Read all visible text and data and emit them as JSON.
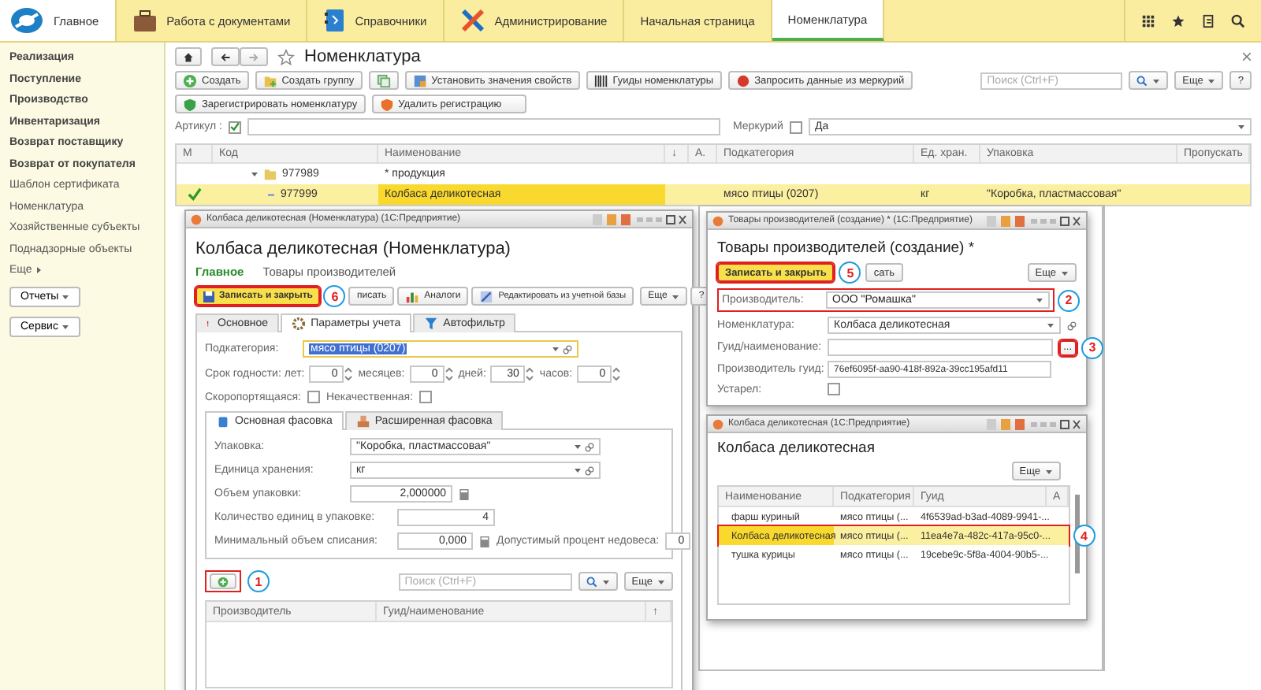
{
  "top_bar": {
    "sections": [
      {
        "label": "Главное",
        "kind": "logo"
      },
      {
        "label": "Работа с документами",
        "kind": "briefcase"
      },
      {
        "label": "Справочники",
        "kind": "book"
      },
      {
        "label": "Администрирование",
        "kind": "tools"
      }
    ],
    "tabs": [
      {
        "label": "Начальная страница",
        "selected": false
      },
      {
        "label": "Номенклатура",
        "selected": true
      }
    ]
  },
  "sidebar": {
    "items": [
      {
        "label": "Реализация",
        "kind": "section"
      },
      {
        "label": "Поступление",
        "kind": "section"
      },
      {
        "label": "Производство",
        "kind": "section"
      },
      {
        "label": "Инвентаризация",
        "kind": "section"
      },
      {
        "label": "Возврат поставщику",
        "kind": "section"
      },
      {
        "label": "Возврат от покупателя",
        "kind": "section"
      },
      {
        "label": "Шаблон сертификата",
        "kind": "link"
      },
      {
        "label": "Номенклатура",
        "kind": "link"
      },
      {
        "label": "Хозяйственные субъекты",
        "kind": "link"
      },
      {
        "label": "Поднадзорные объекты",
        "kind": "link"
      },
      {
        "label": "Еще",
        "kind": "more"
      }
    ],
    "buttons": [
      "Отчеты",
      "Сервис"
    ]
  },
  "list_page": {
    "title": "Номенклатура",
    "toolbar": [
      {
        "label": "Создать",
        "kind": "create"
      },
      {
        "label": "Создать группу",
        "kind": "group"
      },
      {
        "kind": "copy"
      },
      {
        "label": "Установить значения свойств",
        "kind": "properties"
      },
      {
        "label": "Гуиды номенклатуры",
        "kind": "barcode"
      },
      {
        "label": "Запросить данные из меркурий",
        "kind": "request"
      }
    ],
    "toolbar2": [
      {
        "label": "Зарегистрировать номенклатуру",
        "kind": "register"
      },
      {
        "label": "Удалить регистрацию",
        "kind": "unregister"
      }
    ],
    "search_placeholder": "Поиск (Ctrl+F)",
    "more": "Еще",
    "help": "?",
    "filters": {
      "article_label": "Артикул :",
      "article_checked": true,
      "mercury_label": "Меркурий",
      "mercury_checked": false,
      "mercury_value": "Да"
    },
    "table": {
      "columns": [
        "М",
        "Код",
        "Наименование",
        "↓",
        "А.",
        "Подкатегория",
        "Ед. хран.",
        "Упаковка",
        "Пропускать"
      ],
      "rows": [
        {
          "kind": "group",
          "expanded": true,
          "marked": false,
          "selected": false,
          "cells": [
            "",
            "977989",
            "* продукция",
            "",
            "",
            "",
            "",
            "",
            ""
          ]
        },
        {
          "kind": "item",
          "marked": true,
          "selected": true,
          "cells": [
            "",
            "977999",
            "Колбаса деликотесная",
            "",
            "",
            "мясо птицы (0207)",
            "кг",
            "\"Коробка, пластмассовая\"",
            ""
          ]
        }
      ]
    }
  },
  "item_window": {
    "title": "Колбаса деликотесная (Номенклатура) (1С:Предприятие)",
    "heading": "Колбаса деликотесная (Номенклатура)",
    "nav": [
      {
        "label": "Главное",
        "selected": true
      },
      {
        "label": "Товары производителей",
        "selected": false
      }
    ],
    "save_close": "Записать и закрыть",
    "callout_save": "6",
    "save": "писать",
    "analogs": "Аналоги",
    "edit_base": "Редактировать из учетной базы",
    "more": "Еще",
    "help": "?",
    "tabs": [
      {
        "label": "Основное",
        "selected": false,
        "kind": "warning"
      },
      {
        "label": "Параметры учета",
        "selected": true,
        "kind": "gear"
      },
      {
        "label": "Автофильтр",
        "selected": false,
        "kind": "filter"
      }
    ],
    "subcategory_label": "Подкатегория:",
    "subcategory": "мясо птицы (0207)",
    "shelf_life": [
      {
        "label": "Срок годности: лет:",
        "value": "0"
      },
      {
        "label": "месяцев:",
        "value": "0"
      },
      {
        "label": "дней:",
        "value": "30"
      },
      {
        "label": "часов:",
        "value": "0"
      }
    ],
    "flags": [
      {
        "label": "Скоропортящаяся:",
        "checked": false
      },
      {
        "label": "Некачественная:",
        "checked": false
      }
    ],
    "pack_tabs": [
      {
        "label": "Основная фасовка",
        "selected": true
      },
      {
        "label": "Расширенная фасовка",
        "selected": false
      }
    ],
    "packaging_label": "Упаковка:",
    "packaging": "\"Коробка, пластмассовая\"",
    "unit_label": "Единица хранения:",
    "unit": "кг",
    "volume_label": "Объем упаковки:",
    "volume": "2,000000",
    "count_label": "Количество единиц в упаковке:",
    "count": "4",
    "min_label": "Минимальный объем списания:",
    "min": "0,000",
    "underweight_label": "Допустимый процент недовеса:",
    "underweight": "0",
    "callout_add": "1",
    "search_placeholder": "Поиск (Ctrl+F)",
    "table_more": "Еще",
    "columns": [
      "Производитель",
      "Гуид/наименование",
      "↑"
    ]
  },
  "producer_window": {
    "title": "Товары производителей (создание) * (1С:Предприятие)",
    "heading": "Товары производителей (создание) *",
    "save_close": "Записать и закрыть",
    "callout_save": "5",
    "save": "сать",
    "more": "Еще",
    "producer_label": "Производитель:",
    "producer": "ООО \"Ромашка\"",
    "callout_producer": "2",
    "item_label": "Номенклатура:",
    "item": "Колбаса деликотесная",
    "guid_label": "Гуид/наименование:",
    "guid_button": "...",
    "callout_guid": "3",
    "producer_guid_label": "Производитель гуид:",
    "producer_guid": "76ef6095f-aa90-418f-892a-39cc195afd11",
    "obsolete_label": "Устарел:",
    "obsolete": false
  },
  "picker_window": {
    "title": "Колбаса деликотесная (1С:Предприятие)",
    "heading": "Колбаса деликотесная",
    "more": "Еще",
    "columns": [
      "Наименование",
      "Подкатегория",
      "Гуид",
      "А"
    ],
    "rows": [
      {
        "cells": [
          "фарш куриный",
          "мясо птицы (...",
          "4f6539ad-b3ad-4089-9941-..."
        ],
        "selected": false
      },
      {
        "cells": [
          "Колбаса деликотесная",
          "мясо птицы (...",
          "11ea4e7a-482c-417a-95c0-..."
        ],
        "selected": true,
        "callout": "4"
      },
      {
        "cells": [
          "тушка курицы",
          "мясо птицы (...",
          "19cebe9c-5f8a-4004-90b5-..."
        ],
        "selected": false
      }
    ]
  }
}
